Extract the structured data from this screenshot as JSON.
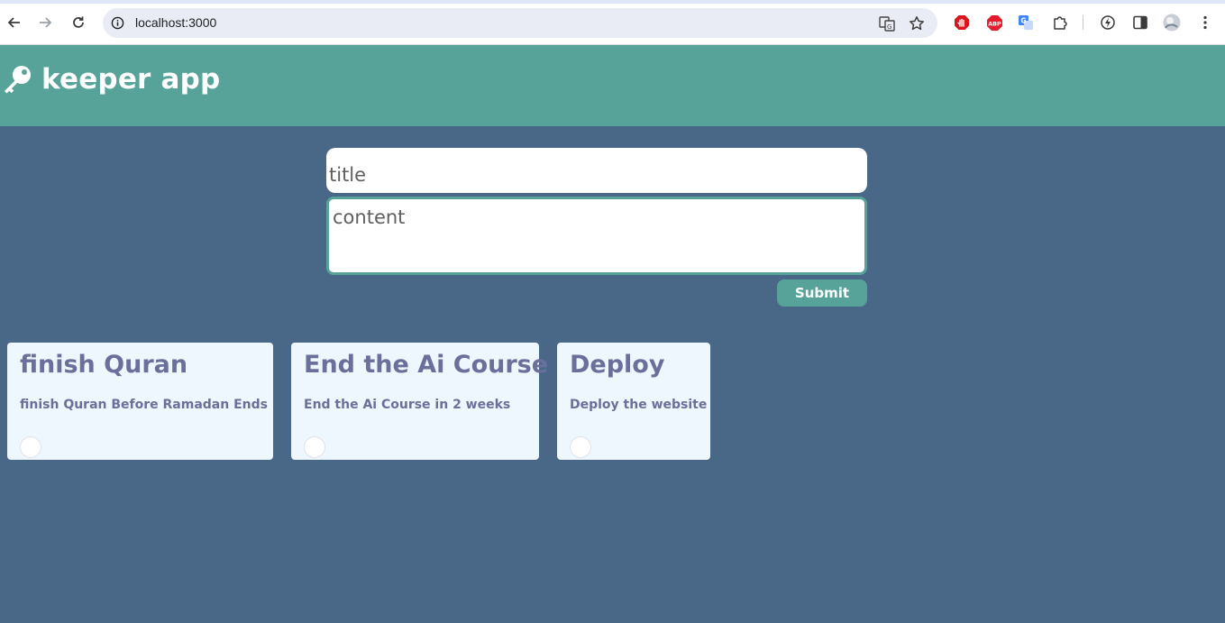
{
  "browser": {
    "url": "localhost:3000",
    "icons": {
      "back": "arrow-left-icon",
      "forward": "arrow-right-icon",
      "reload": "reload-icon",
      "site_info": "info-icon",
      "translate": "translate-icon",
      "bookmark": "star-icon",
      "extensions": [
        "hand-stop-icon",
        "abp-icon",
        "google-translate-icon",
        "puzzle-icon",
        "lightning-icon",
        "side-panel-icon",
        "profile-avatar",
        "kebab-menu-icon"
      ]
    },
    "abp_label": "ABP"
  },
  "header": {
    "title": "keeper app",
    "logo_icon": "key-icon"
  },
  "form": {
    "title_placeholder": "title",
    "content_placeholder": "content",
    "submit_label": "Submit"
  },
  "notes": [
    {
      "title": "finish Quran",
      "content": "finish Quran Before Ramadan Ends"
    },
    {
      "title": "End the Ai Course",
      "content": "End the Ai Course in 2 weeks"
    },
    {
      "title": "Deploy",
      "content": "Deploy the website"
    }
  ],
  "colors": {
    "background": "#496887",
    "header": "#58a399",
    "note_bg": "#eef7fd",
    "note_text": "#6b6f9b",
    "accent": "#58a399"
  }
}
